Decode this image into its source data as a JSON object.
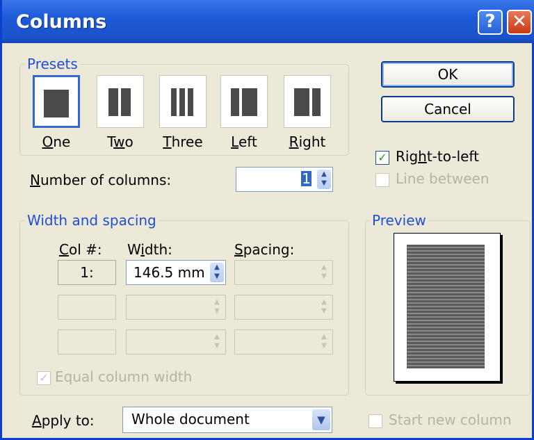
{
  "title": "Columns",
  "titlebar": {
    "help_glyph": "?",
    "close_glyph": "✕"
  },
  "presets": {
    "label": "Presets",
    "items": [
      {
        "label": "One",
        "key": "O",
        "rest": "ne"
      },
      {
        "label": "Two",
        "pre": "T",
        "key": "w",
        "rest": "o"
      },
      {
        "label": "Three",
        "key": "T",
        "rest": "hree"
      },
      {
        "label": "Left",
        "key": "L",
        "rest": "eft"
      },
      {
        "label": "Right",
        "key": "R",
        "rest": "ight"
      }
    ],
    "selected": "One"
  },
  "buttons": {
    "ok": "OK",
    "cancel": "Cancel"
  },
  "options": {
    "right_to_left": {
      "pre": "Rig",
      "key": "h",
      "rest": "t-to-left",
      "checked": true,
      "check_glyph": "✓"
    },
    "line_between": {
      "label": "Line between",
      "checked": false
    },
    "start_new_column": {
      "label": "Start new column",
      "checked": false
    }
  },
  "number_of_columns": {
    "key": "N",
    "rest": "umber of columns:",
    "value": "1"
  },
  "width_spacing": {
    "label": "Width and spacing",
    "col_header": {
      "key": "C",
      "rest": "ol #:"
    },
    "width_header": {
      "pre": "W",
      "key": "i",
      "rest": "dth:"
    },
    "spacing_header": {
      "key": "S",
      "rest": "pacing:"
    },
    "rows": [
      {
        "col": "1:",
        "width": "146.5 mm",
        "spacing": ""
      },
      {
        "col": "",
        "width": "",
        "spacing": ""
      },
      {
        "col": "",
        "width": "",
        "spacing": ""
      }
    ],
    "equal_width": {
      "label": "Equal column width",
      "checked": true,
      "check_glyph": "✓"
    }
  },
  "preview": {
    "label": "Preview"
  },
  "apply_to": {
    "key": "A",
    "rest": "pply to:",
    "value": "Whole document"
  },
  "spin_glyphs": {
    "up": "▲",
    "down": "▼",
    "dropdown": "▼"
  }
}
